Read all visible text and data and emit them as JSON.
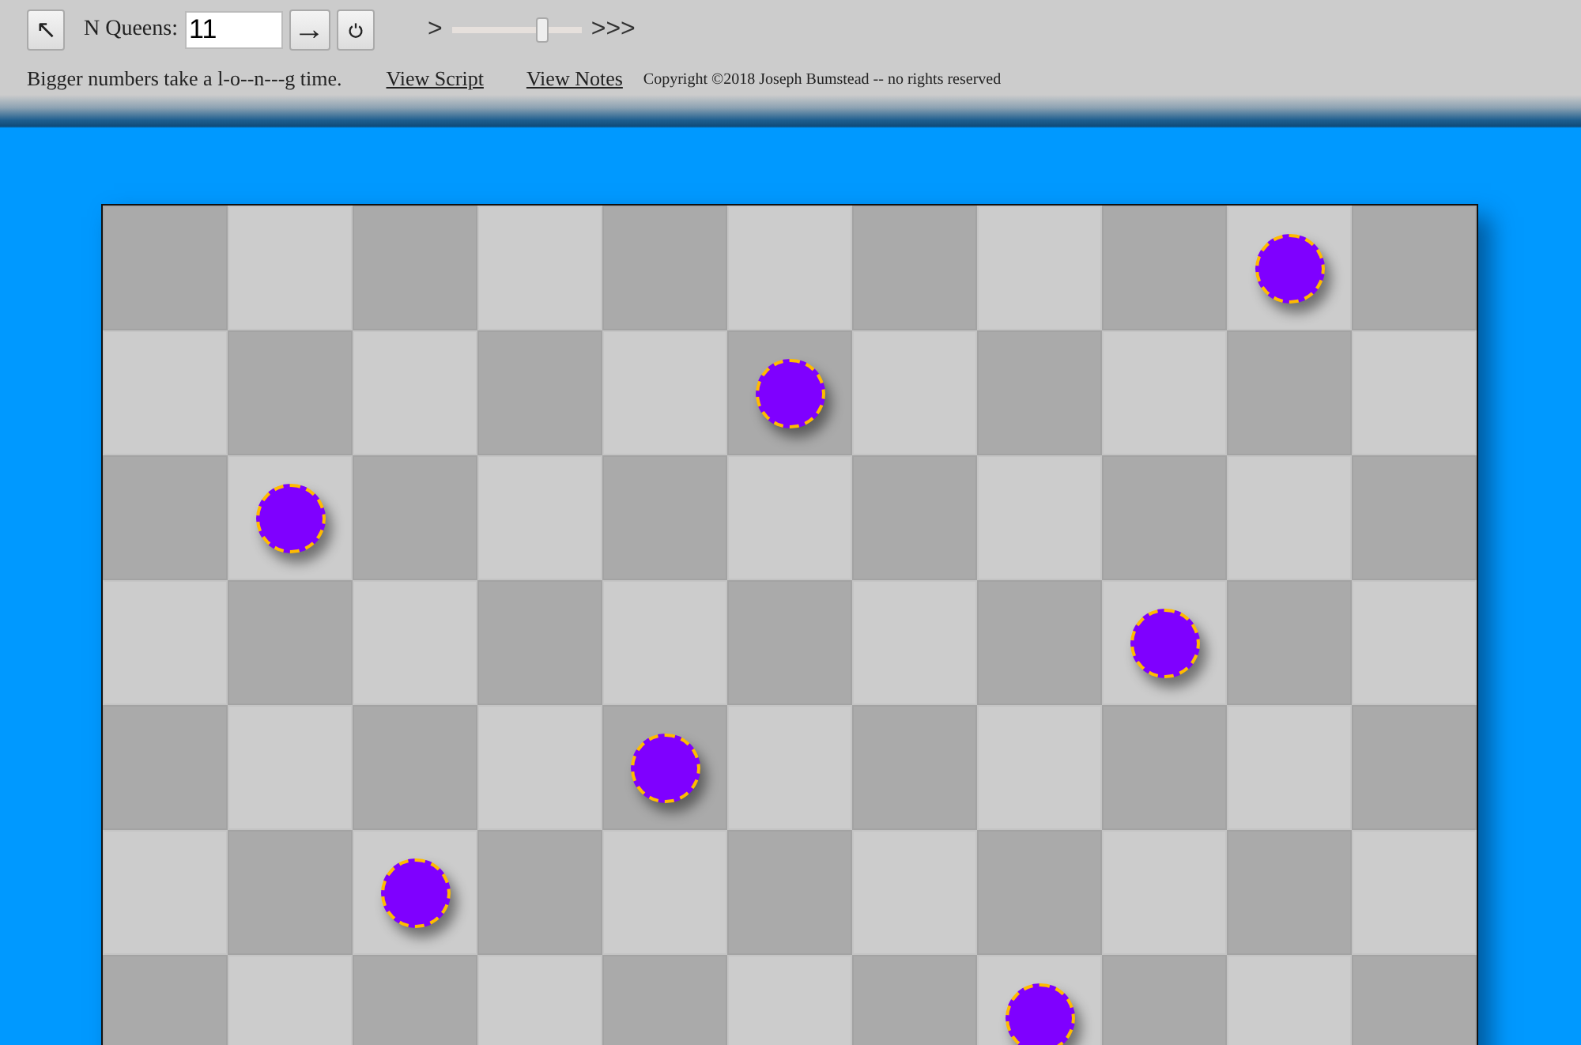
{
  "toolbar": {
    "back_button": "↖",
    "queens_label": "N Queens:",
    "queens_input": {
      "value": "11"
    },
    "go_button": "→",
    "speed": {
      "slow_label": ">",
      "fast_label": ">>>",
      "level": 0.7
    }
  },
  "info": {
    "hint": "Bigger numbers take a l-o--n---g time.",
    "links": [
      "View Script",
      "View Notes"
    ],
    "copyright": "Copyright ©2018 Joseph Bumstead -- no rights reserved"
  },
  "board": {
    "rows": [
      {
        "squares": [
          {
            "queen": false
          },
          {
            "queen": false
          },
          {
            "queen": false
          },
          {
            "queen": false
          },
          {
            "queen": false
          },
          {
            "queen": false
          },
          {
            "queen": false
          },
          {
            "queen": false
          },
          {
            "queen": false
          },
          {
            "queen": true
          },
          {
            "queen": false
          }
        ]
      },
      {
        "squares": [
          {
            "queen": false
          },
          {
            "queen": false
          },
          {
            "queen": false
          },
          {
            "queen": false
          },
          {
            "queen": false
          },
          {
            "queen": true
          },
          {
            "queen": false
          },
          {
            "queen": false
          },
          {
            "queen": false
          },
          {
            "queen": false
          },
          {
            "queen": false
          }
        ]
      },
      {
        "squares": [
          {
            "queen": false
          },
          {
            "queen": true
          },
          {
            "queen": false
          },
          {
            "queen": false
          },
          {
            "queen": false
          },
          {
            "queen": false
          },
          {
            "queen": false
          },
          {
            "queen": false
          },
          {
            "queen": false
          },
          {
            "queen": false
          },
          {
            "queen": false
          }
        ]
      },
      {
        "squares": [
          {
            "queen": false
          },
          {
            "queen": false
          },
          {
            "queen": false
          },
          {
            "queen": false
          },
          {
            "queen": false
          },
          {
            "queen": false
          },
          {
            "queen": false
          },
          {
            "queen": false
          },
          {
            "queen": true
          },
          {
            "queen": false
          },
          {
            "queen": false
          }
        ]
      },
      {
        "squares": [
          {
            "queen": false
          },
          {
            "queen": false
          },
          {
            "queen": false
          },
          {
            "queen": false
          },
          {
            "queen": true
          },
          {
            "queen": false
          },
          {
            "queen": false
          },
          {
            "queen": false
          },
          {
            "queen": false
          },
          {
            "queen": false
          },
          {
            "queen": false
          }
        ]
      },
      {
        "squares": [
          {
            "queen": false
          },
          {
            "queen": false
          },
          {
            "queen": true
          },
          {
            "queen": false
          },
          {
            "queen": false
          },
          {
            "queen": false
          },
          {
            "queen": false
          },
          {
            "queen": false
          },
          {
            "queen": false
          },
          {
            "queen": false
          },
          {
            "queen": false
          }
        ]
      },
      {
        "squares": [
          {
            "queen": false
          },
          {
            "queen": false
          },
          {
            "queen": false
          },
          {
            "queen": false
          },
          {
            "queen": false
          },
          {
            "queen": false
          },
          {
            "queen": false
          },
          {
            "queen": true
          },
          {
            "queen": false
          },
          {
            "queen": false
          },
          {
            "queen": false
          }
        ]
      }
    ]
  }
}
